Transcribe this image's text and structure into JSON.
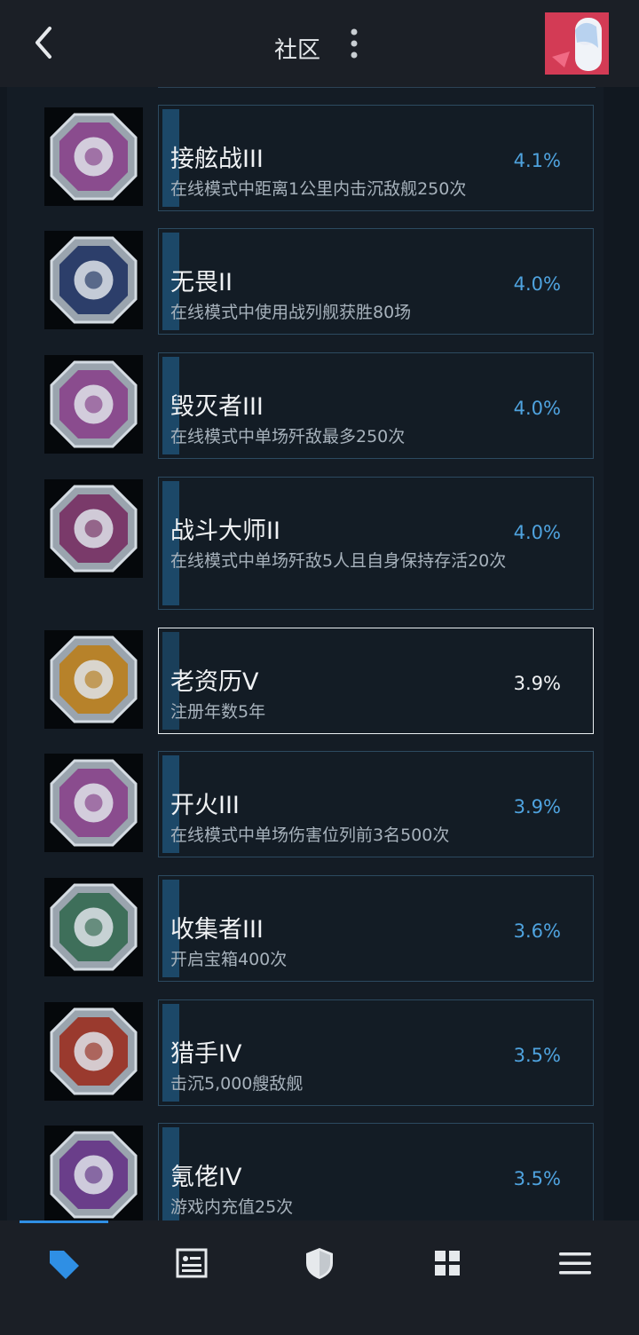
{
  "header": {
    "title": "社区",
    "back_icon": "chevron-left-icon",
    "more_icon": "more-vertical-icon"
  },
  "achievements": [
    {
      "name": "接舷战III",
      "desc": "在线模式中距离1公里内击沉敌舰250次",
      "pct": "4.1%",
      "badge": "pirate-badge-icon",
      "badge_color": "#8a4c8e"
    },
    {
      "name": "无畏II",
      "desc": "在线模式中使用战列舰获胜80场",
      "pct": "4.0%",
      "badge": "battleship-badge-icon",
      "badge_color": "#2c3e6a"
    },
    {
      "name": "毁灭者III",
      "desc": "在线模式中单场歼敌最多250次",
      "pct": "4.0%",
      "badge": "skull-badge-icon",
      "badge_color": "#8a4c8e"
    },
    {
      "name": "战斗大师II",
      "desc": "在线模式中单场歼敌5人且自身保持存活20次",
      "pct": "4.0%",
      "badge": "star-ship-badge-icon",
      "badge_color": "#7a3a6a"
    },
    {
      "name": "老资历V",
      "desc": "注册年数5年",
      "pct": "3.9%",
      "badge": "veteran-badge-icon",
      "badge_color": "#b7822a",
      "selected": true
    },
    {
      "name": "开火III",
      "desc": "在线模式中单场伤害位列前3名500次",
      "pct": "3.9%",
      "badge": "fire-badge-icon",
      "badge_color": "#8a4c8e"
    },
    {
      "name": "收集者III",
      "desc": "开启宝箱400次",
      "pct": "3.6%",
      "badge": "chest-badge-icon",
      "badge_color": "#3e6f5a"
    },
    {
      "name": "猎手IV",
      "desc": "击沉5,000艘敌舰",
      "pct": "3.5%",
      "badge": "hunter-badge-icon",
      "badge_color": "#9a3a2e"
    },
    {
      "name": "氪佬IV",
      "desc": "游戏内充值25次",
      "pct": "3.5%",
      "badge": "payment-badge-icon",
      "badge_color": "#6a3e8a"
    }
  ],
  "nav": [
    {
      "icon": "tag-icon",
      "active": true
    },
    {
      "icon": "profile-card-icon",
      "active": false
    },
    {
      "icon": "shield-icon",
      "active": false
    },
    {
      "icon": "grid-icon",
      "active": false
    },
    {
      "icon": "menu-icon",
      "active": false
    }
  ],
  "colors": {
    "accent": "#2f8fe4",
    "percent": "#4fa3df",
    "background": "#111820",
    "bar": "#1b1f26"
  }
}
